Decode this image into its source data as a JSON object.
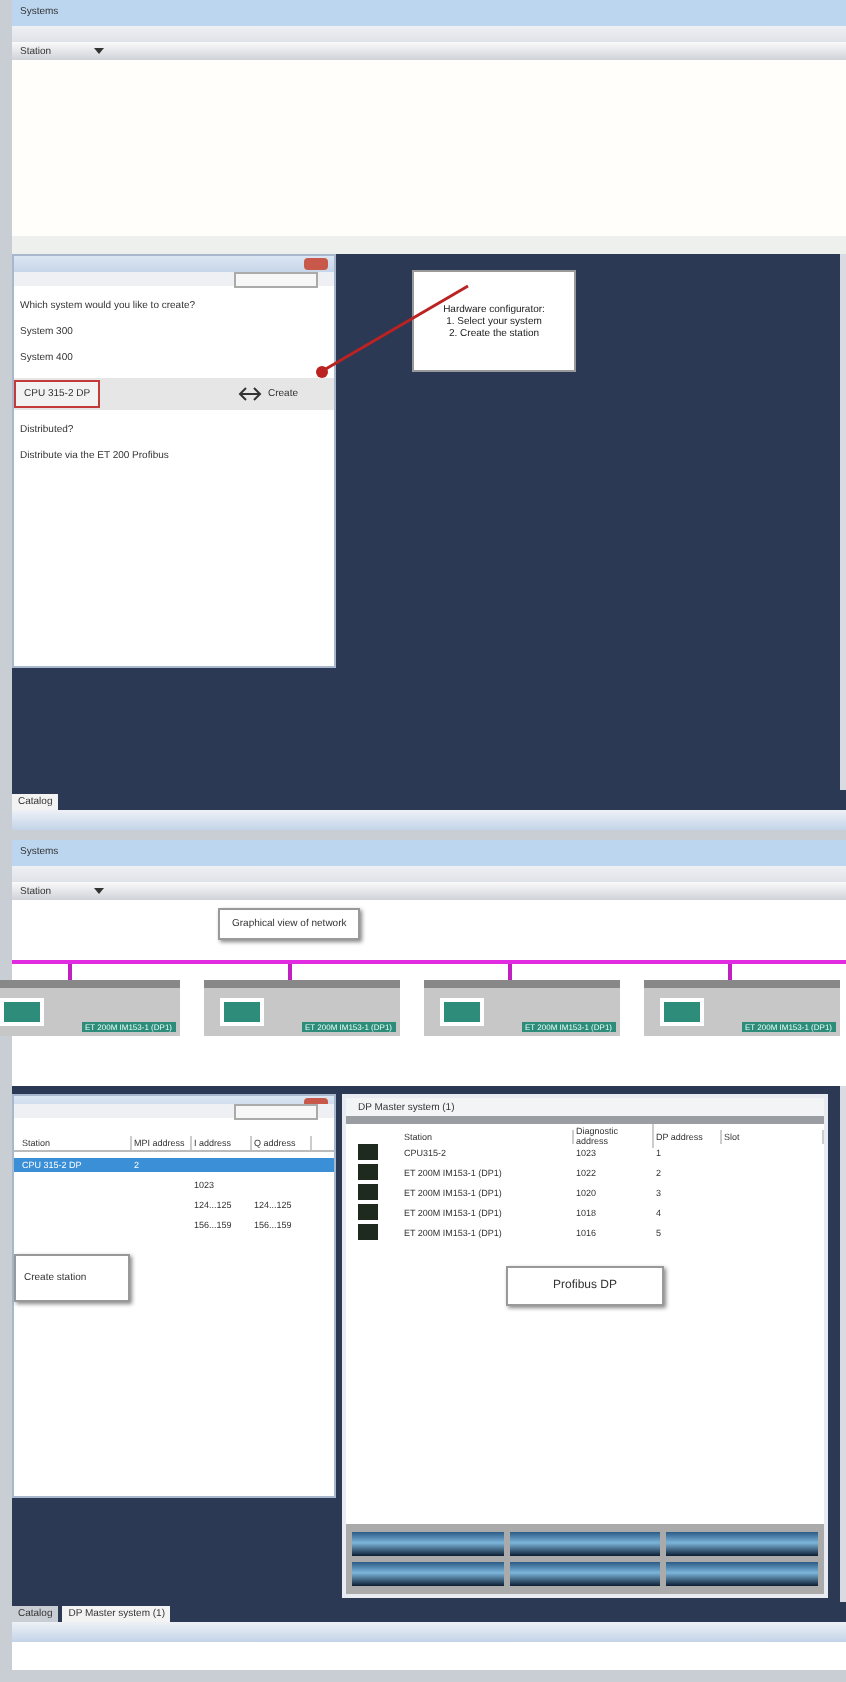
{
  "top": {
    "title": "Systems",
    "combo": "Station",
    "dialog": {
      "question": "Which system would you like to create?",
      "options": [
        "System 300",
        "System 400"
      ],
      "selected_system": "CPU 315-2 DP",
      "create_button": "Create",
      "notes": [
        "Distributed?",
        "Distribute via the ET 200 Profibus"
      ]
    },
    "callout": [
      "Hardware configurator:",
      "1. Select your system",
      "2. Create the station"
    ],
    "tabs": [
      {
        "label": "Catalog",
        "selected": true
      }
    ]
  },
  "bottom": {
    "title": "Systems",
    "combo": "Station",
    "network_callout": "Graphical view of network",
    "stations": [
      "ET 200M IM153-1 (DP1)",
      "ET 200M IM153-1 (DP1)",
      "ET 200M IM153-1 (DP1)",
      "ET 200M IM153-1 (DP1)"
    ],
    "station_table": {
      "columns": [
        "Station",
        "MPI address",
        "I address",
        "Q address"
      ],
      "rows": [
        {
          "cells": [
            "CPU 315-2 DP",
            "2",
            "",
            ""
          ],
          "selected": true
        },
        {
          "cells": [
            "",
            "",
            "1023",
            ""
          ],
          "selected": false
        },
        {
          "cells": [
            "",
            "",
            "124...125",
            "124...125"
          ],
          "selected": false
        },
        {
          "cells": [
            "",
            "",
            "156...159",
            "156...159"
          ],
          "selected": false
        }
      ],
      "callout": "Create station"
    },
    "dp_window": {
      "title": "DP Master system (1)",
      "columns": [
        "Station",
        "Diagnostic address",
        "DP address",
        "Slot"
      ],
      "rows": [
        [
          "CPU315-2",
          "1023",
          "1"
        ],
        [
          "ET 200M IM153-1 (DP1)",
          "1022",
          "2"
        ],
        [
          "ET 200M IM153-1 (DP1)",
          "1020",
          "3"
        ],
        [
          "ET 200M IM153-1 (DP1)",
          "1018",
          "4"
        ],
        [
          "ET 200M IM153-1 (DP1)",
          "1016",
          "5"
        ]
      ],
      "callout": "Profibus DP"
    },
    "tabs": [
      {
        "label": "Catalog",
        "selected": false
      },
      {
        "label": "DP Master system (1)",
        "selected": true
      }
    ]
  }
}
